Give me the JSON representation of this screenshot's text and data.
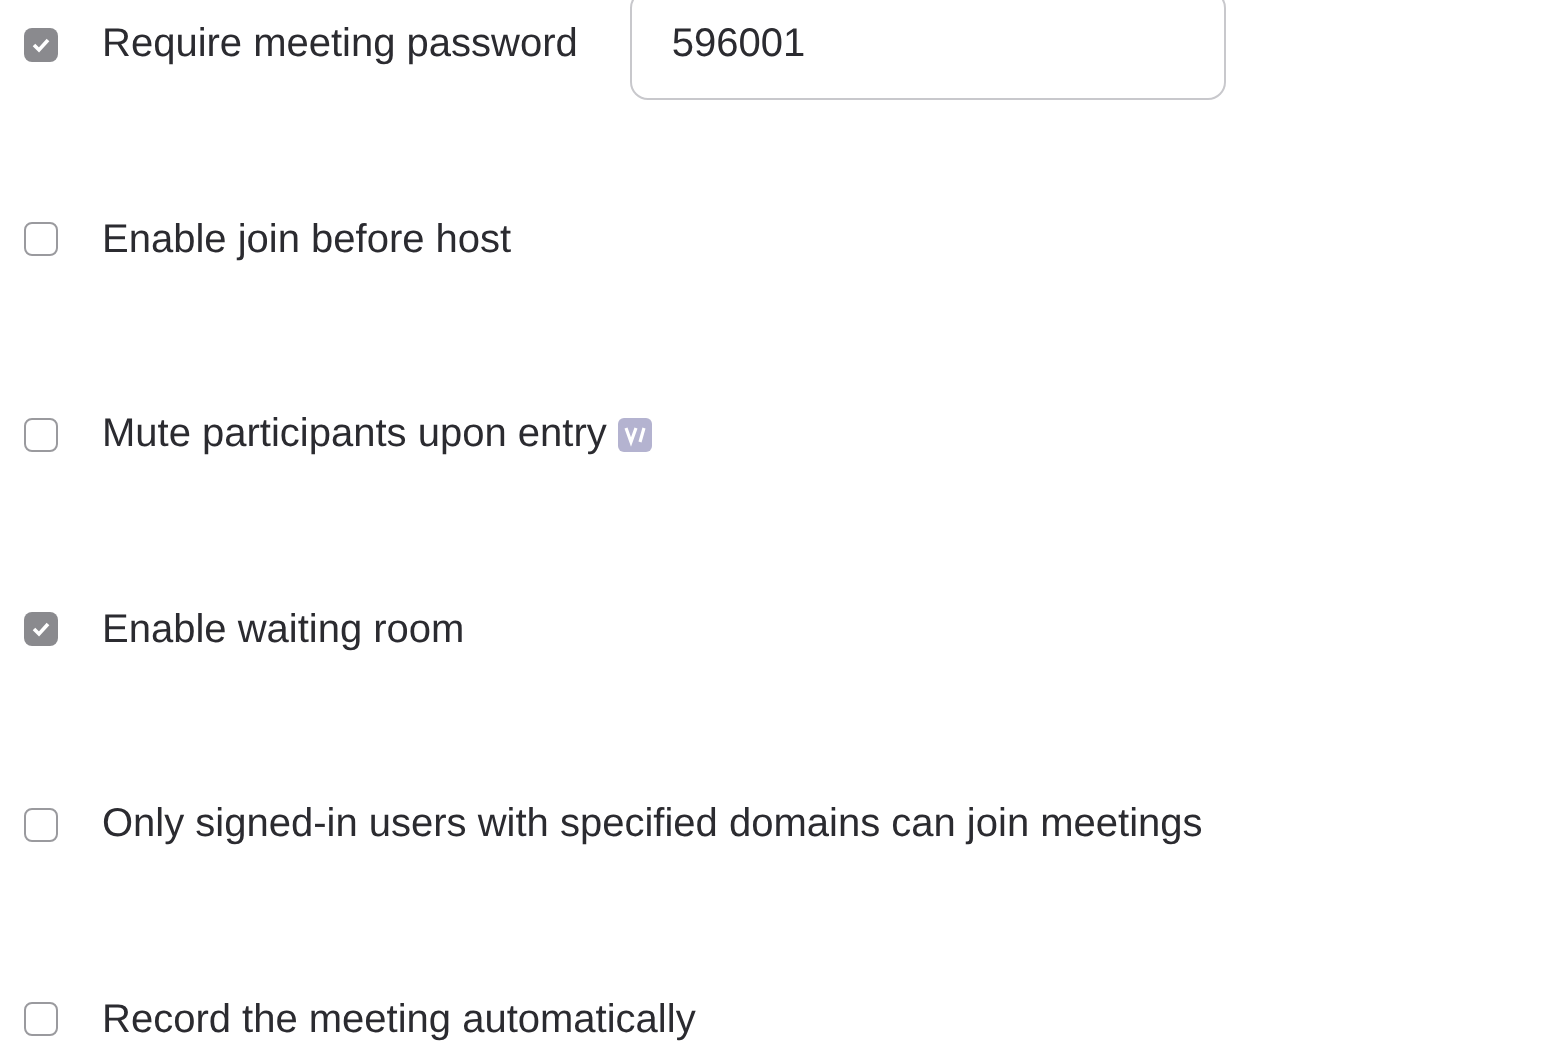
{
  "options": [
    {
      "label": "Require meeting password",
      "checked": true,
      "password": "596001"
    },
    {
      "label": "Enable join before host",
      "checked": false
    },
    {
      "label": "Mute participants upon entry",
      "checked": false,
      "badge": true
    },
    {
      "label": "Enable waiting room",
      "checked": true
    },
    {
      "label": "Only signed-in users with specified domains can join meetings",
      "checked": false
    },
    {
      "label": "Record the meeting automatically",
      "checked": false
    }
  ]
}
